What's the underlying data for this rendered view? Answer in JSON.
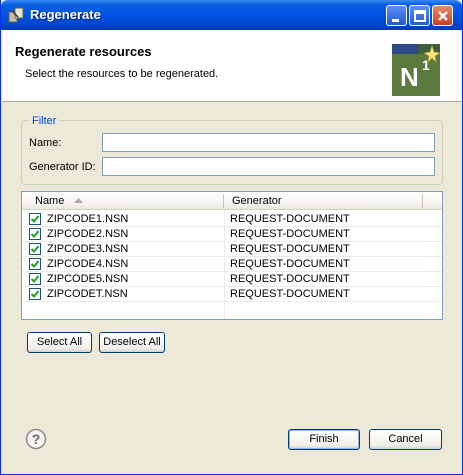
{
  "window": {
    "title": "Regenerate"
  },
  "banner": {
    "title": "Regenerate resources",
    "description": "Select the resources to be regenerated.",
    "logo_text": "N",
    "logo_sup": "1"
  },
  "filter": {
    "legend": "Filter",
    "name_label": "Name:",
    "name_value": "",
    "generator_label": "Generator ID:",
    "generator_value": ""
  },
  "table": {
    "columns": [
      "Name",
      "Generator"
    ],
    "sort_column": "Name",
    "sort_direction": "ascending",
    "rows": [
      {
        "name": "ZIPCODE1.NSN",
        "generator": "REQUEST-DOCUMENT",
        "checked": true
      },
      {
        "name": "ZIPCODE2.NSN",
        "generator": "REQUEST-DOCUMENT",
        "checked": true
      },
      {
        "name": "ZIPCODE3.NSN",
        "generator": "REQUEST-DOCUMENT",
        "checked": true
      },
      {
        "name": "ZIPCODE4.NSN",
        "generator": "REQUEST-DOCUMENT",
        "checked": true
      },
      {
        "name": "ZIPCODE5.NSN",
        "generator": "REQUEST-DOCUMENT",
        "checked": true
      },
      {
        "name": "ZIPCODET.NSN",
        "generator": "REQUEST-DOCUMENT",
        "checked": true
      }
    ]
  },
  "buttons": {
    "select_all": "Select All",
    "deselect_all": "Deselect All",
    "finish": "Finish",
    "cancel": "Cancel"
  },
  "icons": {
    "help": "help-icon",
    "checkbox": "checkbox-checked-icon"
  },
  "colors": {
    "titlebar": "#0054e3",
    "filter_legend": "#0046d5",
    "check": "#21a121"
  }
}
